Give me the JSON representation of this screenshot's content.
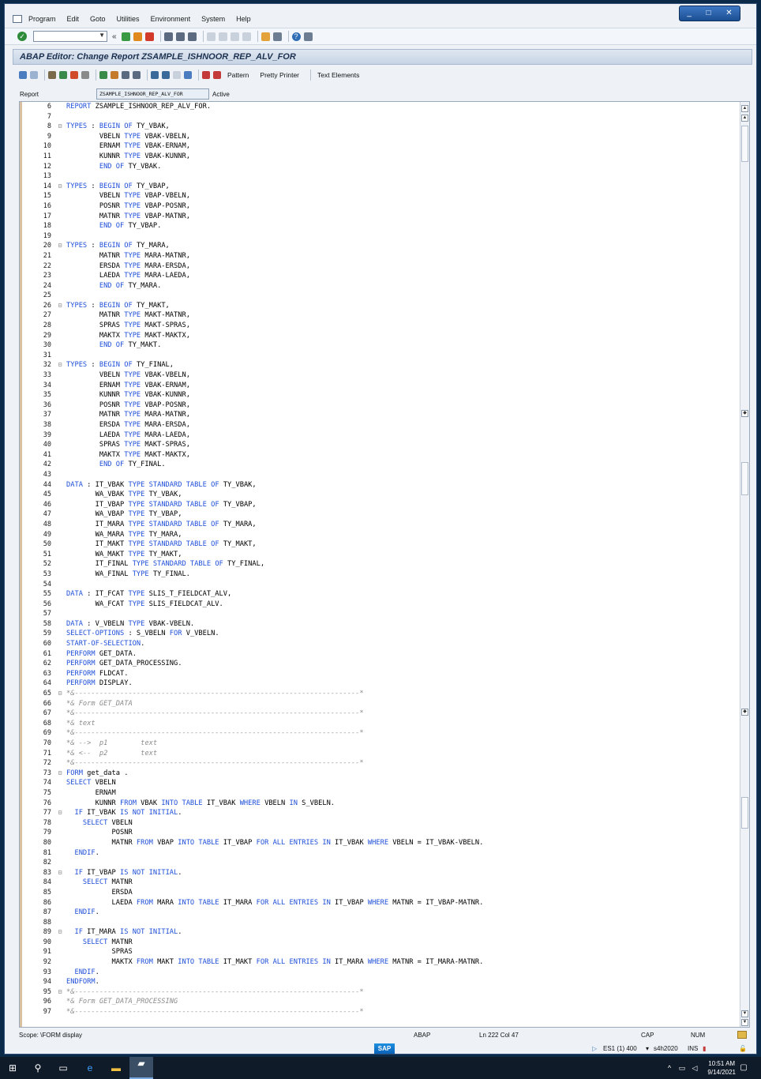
{
  "window": {
    "controls": [
      "_",
      "□",
      "✕"
    ]
  },
  "menu": [
    "Program",
    "Edit",
    "Goto",
    "Utilities",
    "Environment",
    "System",
    "Help"
  ],
  "command_field": {
    "value": ""
  },
  "title": "ABAP Editor: Change Report ZSAMPLE_ISHNOOR_REP_ALV_FOR",
  "toolbar2": {
    "pattern": "Pattern",
    "pretty_printer": "Pretty Printer",
    "text_elements": "Text Elements"
  },
  "report": {
    "label": "Report",
    "value": "ZSAMPLE_ISHNOOR_REP_ALV_FOR",
    "status": "Active"
  },
  "code_lines": [
    {
      "n": "6",
      "t": "REPORT ZSAMPLE_ISHNOOR_REP_ALV_FOR."
    },
    {
      "n": "7",
      "t": ""
    },
    {
      "n": "8",
      "f": "⊟",
      "t": "TYPES : BEGIN OF TY_VBAK,"
    },
    {
      "n": "9",
      "t": "        VBELN TYPE VBAK-VBELN,"
    },
    {
      "n": "10",
      "t": "        ERNAM TYPE VBAK-ERNAM,"
    },
    {
      "n": "11",
      "t": "        KUNNR TYPE VBAK-KUNNR,"
    },
    {
      "n": "12",
      "t": "        END OF TY_VBAK."
    },
    {
      "n": "13",
      "t": ""
    },
    {
      "n": "14",
      "f": "⊟",
      "t": "TYPES : BEGIN OF TY_VBAP,"
    },
    {
      "n": "15",
      "t": "        VBELN TYPE VBAP-VBELN,"
    },
    {
      "n": "16",
      "t": "        POSNR TYPE VBAP-POSNR,"
    },
    {
      "n": "17",
      "t": "        MATNR TYPE VBAP-MATNR,"
    },
    {
      "n": "18",
      "t": "        END OF TY_VBAP."
    },
    {
      "n": "19",
      "t": ""
    },
    {
      "n": "20",
      "f": "⊟",
      "t": "TYPES : BEGIN OF TY_MARA,"
    },
    {
      "n": "21",
      "t": "        MATNR TYPE MARA-MATNR,"
    },
    {
      "n": "22",
      "t": "        ERSDA TYPE MARA-ERSDA,"
    },
    {
      "n": "23",
      "t": "        LAEDA TYPE MARA-LAEDA,"
    },
    {
      "n": "24",
      "t": "        END OF TY_MARA."
    },
    {
      "n": "25",
      "t": ""
    },
    {
      "n": "26",
      "f": "⊟",
      "t": "TYPES : BEGIN OF TY_MAKT,"
    },
    {
      "n": "27",
      "t": "        MATNR TYPE MAKT-MATNR,"
    },
    {
      "n": "28",
      "t": "        SPRAS TYPE MAKT-SPRAS,"
    },
    {
      "n": "29",
      "t": "        MAKTX TYPE MAKT-MAKTX,"
    },
    {
      "n": "30",
      "t": "        END OF TY_MAKT."
    },
    {
      "n": "31",
      "t": ""
    },
    {
      "n": "32",
      "f": "⊟",
      "t": "TYPES : BEGIN OF TY_FINAL,"
    },
    {
      "n": "33",
      "t": "        VBELN TYPE VBAK-VBELN,"
    },
    {
      "n": "34",
      "t": "        ERNAM TYPE VBAK-ERNAM,"
    },
    {
      "n": "35",
      "t": "        KUNNR TYPE VBAK-KUNNR,"
    },
    {
      "n": "36",
      "t": "        POSNR TYPE VBAP-POSNR,"
    },
    {
      "n": "37",
      "t": "        MATNR TYPE MARA-MATNR,"
    },
    {
      "n": "38",
      "t": "        ERSDA TYPE MARA-ERSDA,"
    },
    {
      "n": "39",
      "t": "        LAEDA TYPE MARA-LAEDA,"
    },
    {
      "n": "40",
      "t": "        SPRAS TYPE MAKT-SPRAS,"
    },
    {
      "n": "41",
      "t": "        MAKTX TYPE MAKT-MAKTX,"
    },
    {
      "n": "42",
      "t": "        END OF TY_FINAL."
    },
    {
      "n": "43",
      "t": ""
    },
    {
      "n": "44",
      "t": "DATA : IT_VBAK TYPE STANDARD TABLE OF TY_VBAK,"
    },
    {
      "n": "45",
      "t": "       WA_VBAK TYPE TY_VBAK,"
    },
    {
      "n": "46",
      "t": "       IT_VBAP TYPE STANDARD TABLE OF TY_VBAP,"
    },
    {
      "n": "47",
      "t": "       WA_VBAP TYPE TY_VBAP,"
    },
    {
      "n": "48",
      "t": "       IT_MARA TYPE STANDARD TABLE OF TY_MARA,"
    },
    {
      "n": "49",
      "t": "       WA_MARA TYPE TY_MARA,"
    },
    {
      "n": "50",
      "t": "       IT_MAKT TYPE STANDARD TABLE OF TY_MAKT,"
    },
    {
      "n": "51",
      "t": "       WA_MAKT TYPE TY_MAKT,"
    },
    {
      "n": "52",
      "t": "       IT_FINAL TYPE STANDARD TABLE OF TY_FINAL,"
    },
    {
      "n": "53",
      "t": "       WA_FINAL TYPE TY_FINAL."
    },
    {
      "n": "54",
      "t": ""
    },
    {
      "n": "55",
      "t": "DATA : IT_FCAT TYPE SLIS_T_FIELDCAT_ALV,"
    },
    {
      "n": "56",
      "t": "       WA_FCAT TYPE SLIS_FIELDCAT_ALV."
    },
    {
      "n": "57",
      "t": ""
    },
    {
      "n": "58",
      "t": "DATA : V_VBELN TYPE VBAK-VBELN."
    },
    {
      "n": "59",
      "t": "SELECT-OPTIONS : S_VBELN FOR V_VBELN."
    },
    {
      "n": "60",
      "t": "START-OF-SELECTION."
    },
    {
      "n": "61",
      "t": "PERFORM GET_DATA."
    },
    {
      "n": "62",
      "t": "PERFORM GET_DATA_PROCESSING."
    },
    {
      "n": "63",
      "t": "PERFORM FLDCAT."
    },
    {
      "n": "64",
      "t": "PERFORM DISPLAY."
    },
    {
      "n": "65",
      "f": "⊟",
      "t": "*&---------------------------------------------------------------------*",
      "c": true
    },
    {
      "n": "66",
      "t": "*& Form GET_DATA",
      "c": true
    },
    {
      "n": "67",
      "t": "*&---------------------------------------------------------------------*",
      "c": true
    },
    {
      "n": "68",
      "t": "*& text",
      "c": true
    },
    {
      "n": "69",
      "t": "*&---------------------------------------------------------------------*",
      "c": true
    },
    {
      "n": "70",
      "t": "*& -->  p1        text",
      "c": true
    },
    {
      "n": "71",
      "t": "*& <--  p2        text",
      "c": true
    },
    {
      "n": "72",
      "t": "*&---------------------------------------------------------------------*",
      "c": true
    },
    {
      "n": "73",
      "f": "⊟",
      "t": "FORM get_data ."
    },
    {
      "n": "74",
      "t": "SELECT VBELN"
    },
    {
      "n": "75",
      "t": "       ERNAM"
    },
    {
      "n": "76",
      "t": "       KUNNR FROM VBAK INTO TABLE IT_VBAK WHERE VBELN IN S_VBELN."
    },
    {
      "n": "77",
      "f": "⊟",
      "t": "  IF IT_VBAK IS NOT INITIAL."
    },
    {
      "n": "78",
      "t": "    SELECT VBELN"
    },
    {
      "n": "79",
      "t": "           POSNR"
    },
    {
      "n": "80",
      "t": "           MATNR FROM VBAP INTO TABLE IT_VBAP FOR ALL ENTRIES IN IT_VBAK WHERE VBELN = IT_VBAK-VBELN."
    },
    {
      "n": "81",
      "t": "  ENDIF."
    },
    {
      "n": "82",
      "t": ""
    },
    {
      "n": "83",
      "f": "⊟",
      "t": "  IF IT_VBAP IS NOT INITIAL."
    },
    {
      "n": "84",
      "t": "    SELECT MATNR"
    },
    {
      "n": "85",
      "t": "           ERSDA"
    },
    {
      "n": "86",
      "t": "           LAEDA FROM MARA INTO TABLE IT_MARA FOR ALL ENTRIES IN IT_VBAP WHERE MATNR = IT_VBAP-MATNR."
    },
    {
      "n": "87",
      "t": "  ENDIF."
    },
    {
      "n": "88",
      "t": ""
    },
    {
      "n": "89",
      "f": "⊟",
      "t": "  IF IT_MARA IS NOT INITIAL."
    },
    {
      "n": "90",
      "t": "    SELECT MATNR"
    },
    {
      "n": "91",
      "t": "           SPRAS"
    },
    {
      "n": "92",
      "t": "           MAKTX FROM MAKT INTO TABLE IT_MAKT FOR ALL ENTRIES IN IT_MARA WHERE MATNR = IT_MARA-MATNR."
    },
    {
      "n": "93",
      "t": "  ENDIF."
    },
    {
      "n": "94",
      "t": "ENDFORM."
    },
    {
      "n": "95",
      "f": "⊟",
      "t": "*&---------------------------------------------------------------------*",
      "c": true
    },
    {
      "n": "96",
      "t": "*& Form GET_DATA_PROCESSING",
      "c": true
    },
    {
      "n": "97",
      "t": "*&---------------------------------------------------------------------*",
      "c": true
    }
  ],
  "keywords": [
    "REPORT",
    "TYPES",
    "BEGIN",
    "OF",
    "TYPE",
    "END",
    "DATA",
    "STANDARD",
    "TABLE",
    "SELECT-OPTIONS",
    "FOR",
    "START-OF-SELECTION",
    "PERFORM",
    "FORM",
    "SELECT",
    "FROM",
    "INTO",
    "WHERE",
    "IN",
    "IF",
    "IS",
    "NOT",
    "INITIAL",
    "ENDIF",
    "ALL",
    "ENTRIES",
    "ENDFORM"
  ],
  "status_bar": {
    "scope": "Scope: \\FORM display",
    "language": "ABAP",
    "position": "Ln 222 Col  47",
    "cap": "CAP",
    "num": "NUM"
  },
  "system_bar": {
    "session": "ES1 (1) 400",
    "host": "s4h2020",
    "mode": "INS"
  },
  "taskbar": {
    "time": "10:51 AM",
    "date": "9/14/2021"
  }
}
